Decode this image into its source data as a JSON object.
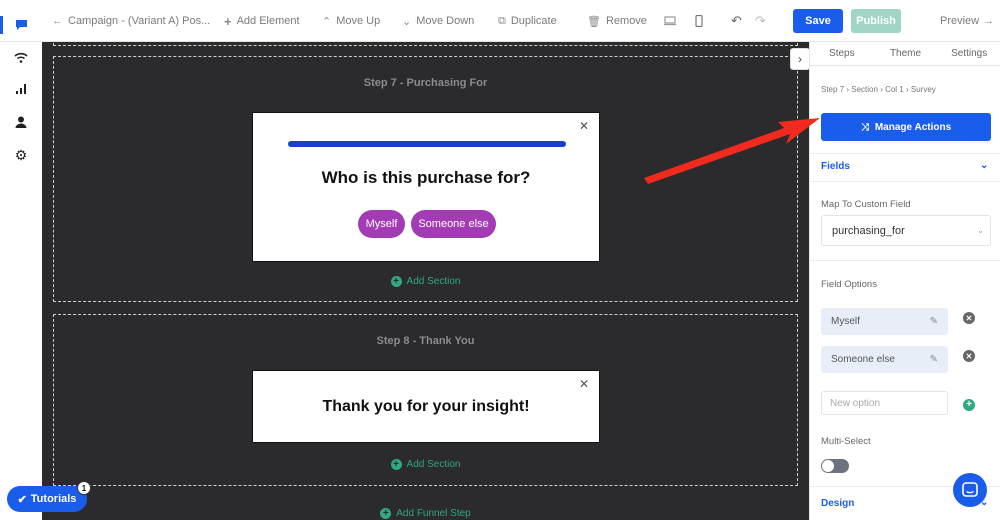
{
  "toolbar": {
    "campaign_title": "Campaign - (Variant A) Pos...",
    "add_element": "Add Element",
    "move_up": "Move Up",
    "move_down": "Move Down",
    "duplicate": "Duplicate",
    "remove": "Remove",
    "save": "Save",
    "publish": "Publish",
    "preview": "Preview"
  },
  "left_rail": {
    "icons": [
      "chat-icon",
      "wifi-icon",
      "chart-icon",
      "user-icon",
      "gear-icon"
    ]
  },
  "canvas": {
    "step7": {
      "title": "Step 7 - Purchasing For",
      "question": "Who is this purchase for?",
      "options": [
        "Myself",
        "Someone else"
      ],
      "add_section": "Add Section"
    },
    "step8": {
      "title": "Step 8 - Thank You",
      "message": "Thank you for your insight!",
      "add_section": "Add Section"
    },
    "add_funnel_step": "Add Funnel Step"
  },
  "right_panel": {
    "tabs": [
      "Steps",
      "Theme",
      "Settings"
    ],
    "breadcrumb": [
      "Step 7",
      "Section",
      "Col 1",
      "Survey"
    ],
    "manage_actions": "Manage Actions",
    "fields_heading": "Fields",
    "map_label": "Map To Custom Field",
    "map_value": "purchasing_for",
    "field_options_label": "Field Options",
    "field_options": [
      "Myself",
      "Someone else"
    ],
    "new_option_placeholder": "New option",
    "multi_select_label": "Multi-Select",
    "multi_select_on": false,
    "design_heading": "Design"
  },
  "tutorials": {
    "label": "Tutorials",
    "badge": "1"
  },
  "colors": {
    "accent": "#1a5dea",
    "option_button": "#a33cb4",
    "add_link": "#2fa883",
    "annotation_arrow": "#f02a1e"
  }
}
